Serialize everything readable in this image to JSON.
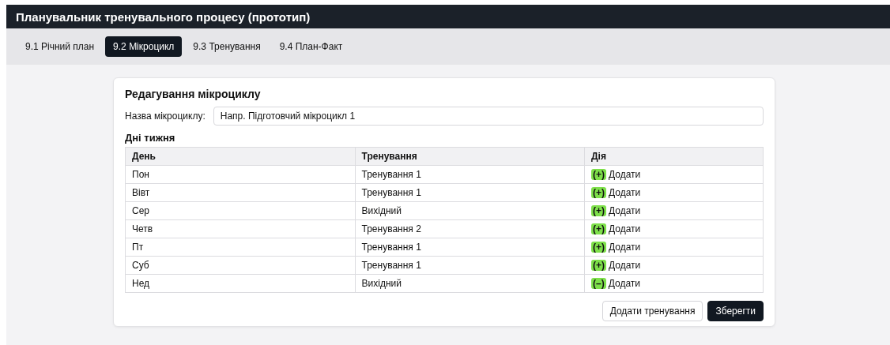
{
  "app": {
    "title": "Планувальник тренувального процесу (прототип)"
  },
  "tabs": [
    {
      "label": "9.1 Річний план",
      "selected": false
    },
    {
      "label": "9.2 Мікроцикл",
      "selected": true
    },
    {
      "label": "9.3 Тренування",
      "selected": false
    },
    {
      "label": "9.4 План-Факт",
      "selected": false
    }
  ],
  "editor": {
    "title": "Редагування мікроциклу",
    "name_label": "Назва мікроциклу:",
    "name_value": "Напр. Підготовчий мікроцикл 1",
    "section_title": "Дні тижня",
    "table": {
      "columns": [
        "День",
        "Тренування",
        "Дія"
      ],
      "rows": [
        {
          "day": "Пон",
          "training": "Тренування 1",
          "badge": "(+)",
          "action": "Додати"
        },
        {
          "day": "Вівт",
          "training": "Тренування 1",
          "badge": "(+)",
          "action": "Додати"
        },
        {
          "day": "Сер",
          "training": "Вихідний",
          "badge": "(+)",
          "action": "Додати"
        },
        {
          "day": "Четв",
          "training": "Тренування 2",
          "badge": "(+)",
          "action": "Додати"
        },
        {
          "day": "Пт",
          "training": "Тренування 1",
          "badge": "(+)",
          "action": "Додати"
        },
        {
          "day": "Суб",
          "training": "Тренування 1",
          "badge": "(+)",
          "action": "Додати"
        },
        {
          "day": "Нед",
          "training": "Вихідний",
          "badge": "(–)",
          "action": "Додати"
        }
      ]
    },
    "buttons": [
      {
        "label": "Додати тренування",
        "kind": "secondary"
      },
      {
        "label": "Зберегти",
        "kind": "primary"
      }
    ]
  }
}
